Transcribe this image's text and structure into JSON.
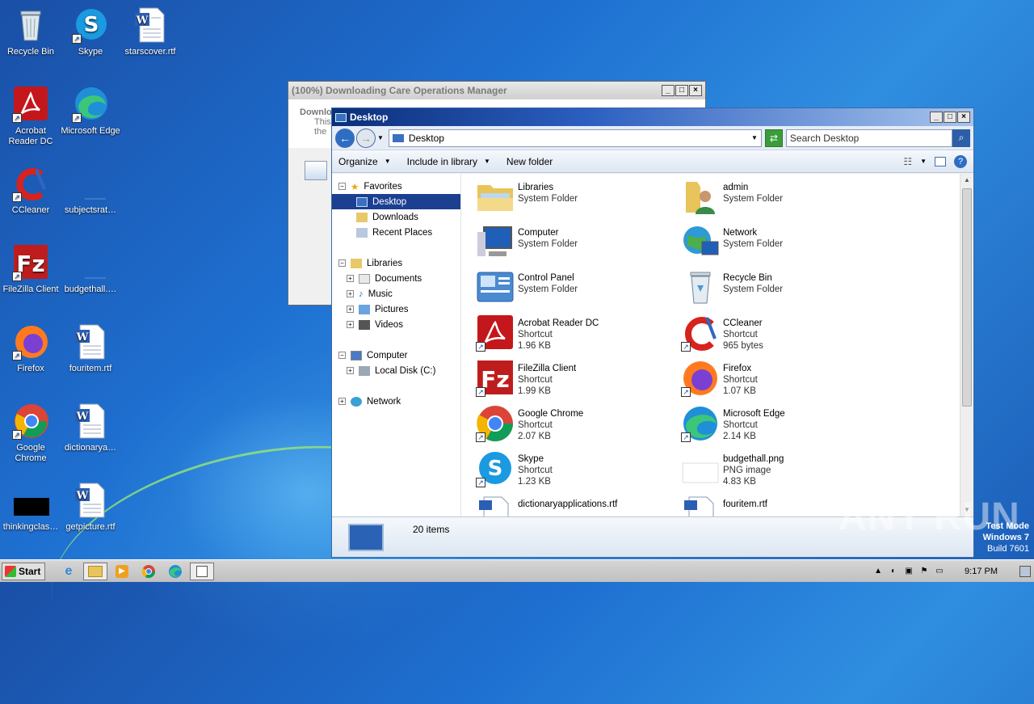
{
  "desktop_icons": [
    {
      "label": "Recycle Bin"
    },
    {
      "label": "Skype"
    },
    {
      "label": "starscover.rtf"
    },
    {
      "label": "Acrobat Reader DC"
    },
    {
      "label": "Microsoft Edge"
    },
    {
      "label": "CCleaner"
    },
    {
      "label": "subjectsrat…"
    },
    {
      "label": "FileZilla Client"
    },
    {
      "label": "budgethall.…"
    },
    {
      "label": "Firefox"
    },
    {
      "label": "fouritem.rtf"
    },
    {
      "label": "Google Chrome"
    },
    {
      "label": "dictionarya…"
    },
    {
      "label": "thinkingclas…"
    },
    {
      "label": "getpicture.rtf"
    }
  ],
  "bg_window": {
    "title": "(100%) Downloading Care Operations Manager",
    "line1": "Downlo",
    "line2": "This",
    "line3": "the"
  },
  "explorer": {
    "title": "Desktop",
    "address": "Desktop",
    "search_placeholder": "Search Desktop",
    "toolbar": {
      "organize": "Organize",
      "include": "Include in library",
      "new_folder": "New folder"
    },
    "nav": {
      "favorites": "Favorites",
      "desktop": "Desktop",
      "downloads": "Downloads",
      "recent": "Recent Places",
      "libraries": "Libraries",
      "documents": "Documents",
      "music": "Music",
      "pictures": "Pictures",
      "videos": "Videos",
      "computer": "Computer",
      "local_disk": "Local Disk (C:)",
      "network": "Network"
    },
    "items": [
      {
        "name": "Libraries",
        "type": "System Folder",
        "size": ""
      },
      {
        "name": "admin",
        "type": "System Folder",
        "size": ""
      },
      {
        "name": "Computer",
        "type": "System Folder",
        "size": ""
      },
      {
        "name": "Network",
        "type": "System Folder",
        "size": ""
      },
      {
        "name": "Control Panel",
        "type": "System Folder",
        "size": ""
      },
      {
        "name": "Recycle Bin",
        "type": "System Folder",
        "size": ""
      },
      {
        "name": "Acrobat Reader DC",
        "type": "Shortcut",
        "size": "1.96 KB"
      },
      {
        "name": "CCleaner",
        "type": "Shortcut",
        "size": "965 bytes"
      },
      {
        "name": "FileZilla Client",
        "type": "Shortcut",
        "size": "1.99 KB"
      },
      {
        "name": "Firefox",
        "type": "Shortcut",
        "size": "1.07 KB"
      },
      {
        "name": "Google Chrome",
        "type": "Shortcut",
        "size": "2.07 KB"
      },
      {
        "name": "Microsoft Edge",
        "type": "Shortcut",
        "size": "2.14 KB"
      },
      {
        "name": "Skype",
        "type": "Shortcut",
        "size": "1.23 KB"
      },
      {
        "name": "budgethall.png",
        "type": "PNG image",
        "size": "4.83 KB"
      },
      {
        "name": "dictionaryapplications.rtf",
        "type": "",
        "size": ""
      },
      {
        "name": "fouritem.rtf",
        "type": "",
        "size": ""
      }
    ],
    "status": "20 items"
  },
  "taskbar": {
    "start": "Start",
    "clock": "9:17 PM"
  },
  "watermark": {
    "line1": "Test Mode",
    "line2": "Windows 7",
    "line3": "Build 7601"
  },
  "anyrun": "ANY RUN"
}
